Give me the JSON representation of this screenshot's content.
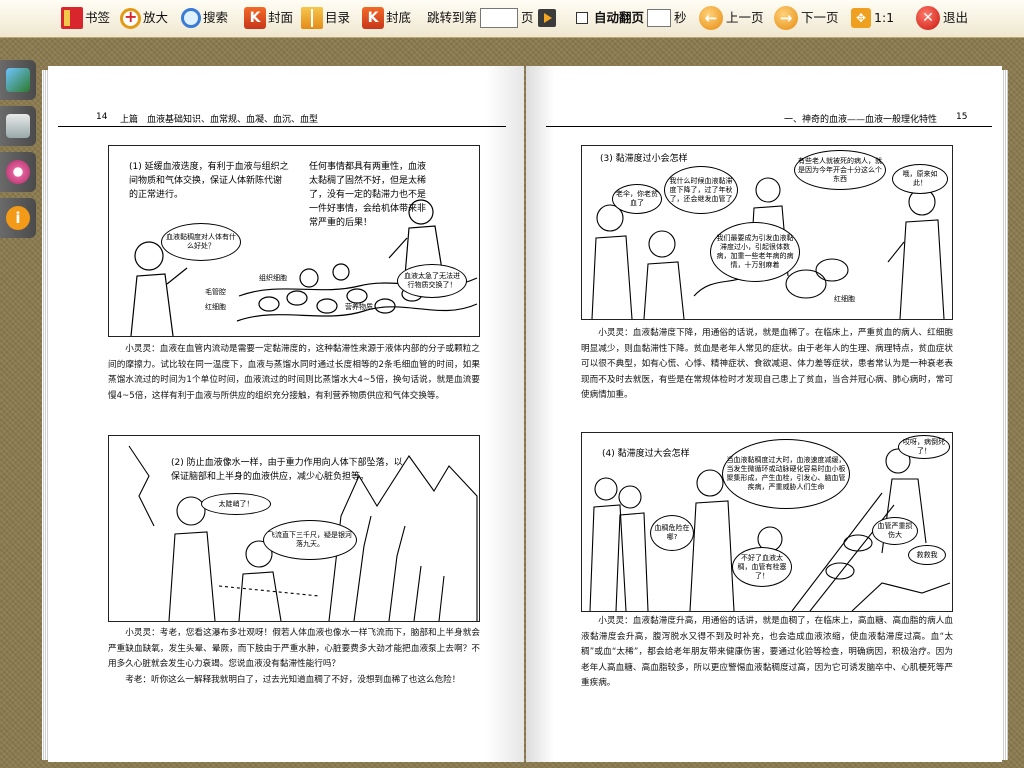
{
  "toolbar": {
    "bookmark": "书签",
    "zoom": "放大",
    "search": "搜索",
    "cover": "封面",
    "cover_icon": "K",
    "contents": "目录",
    "back_cover": "封底",
    "back_cover_icon": "K",
    "goto_prefix": "跳转到第",
    "goto_suffix": "页",
    "auto_flip": "自动翻页",
    "seconds": "秒",
    "prev": "上一页",
    "next": "下一页",
    "ratio": "1:1",
    "exit": "退出"
  },
  "left_page": {
    "page_number": "14",
    "running_head": "上篇　血液基础知识、血常规、血凝、血沉、血型",
    "panel1": {
      "caption_a": "(1) 延缓血液迭度，有利于血液与组织之间物质和气体交换，保证人体新陈代谢的正常进行。",
      "caption_b": "任何事情都具有两重性，血液太黏稠了固然不好，但是太稀了，没有一定的黏滞力也不是一件好事情，会给机体带来非常严重的后果！",
      "bubble_elder": "血液黏稠度对人体有什么好处？",
      "bubble_right": "血液太急了无法进行物质交换了！",
      "label_cells": "组织细胞",
      "label_capillary": "毛管腔",
      "label_rbc": "红细胞",
      "label_nutrients": "营养物质"
    },
    "text1": "小灵灵：血液在血管内流动是需要一定黏滞度的，这种黏滞性来源于液体内部的分子或颗粒之间的摩擦力。试比较在同一温度下，血液与蒸馏水同时通过长度相等的2条毛细血管的时间，如果蒸馏水流过的时间为1个单位时间，血液流过的时间则比蒸馏水大4~5倍，换句话说，就是血流要慢4~5倍，这样有利于血液与所供应的组织充分接触，有利营养物质供应和气体交换等。",
    "panel2": {
      "caption": "(2) 防止血液像水一样，由于重力作用向人体下部坠落，以保证脑部和上半身的血液供应，减少心脏负担等。",
      "bubble_hiker": "太陡峭了！",
      "bubble_mid": "飞流直下三千尺，疑是银河落九天。"
    },
    "text2a": "小灵灵：考老，您看这瀑布多壮观呀！假若人体血液也像水一样飞流而下，脑部和上半身就会严重缺血缺氧，发生头晕、晕厥，而下肢由于严重水肿，心脏要费多大劲才能把血液泵上去啊？不用多久心脏就会发生心力衰竭。您说血液没有黏滞性能行吗？",
    "text2b": "考老：听你这么一解释我就明白了，过去光知道血稠了不好，没想到血稀了也这么危险！"
  },
  "right_page": {
    "page_number": "15",
    "running_head": "一、神奇的血液——血液一般理化特性",
    "panel1": {
      "caption": "(3) 黏滞度过小会怎样",
      "bubble_old": "老伞，你老贫血了",
      "bubble_boy": "我什么时候血液黏滞度下降了，过了年秋了，还会继发血管了",
      "bubble_doc": "有些老人就被死的病人，就是因为今年开会十分这么个东西",
      "bubble_man": "我们最要成为引发血液黏滞度过小，引起很体数病，加重一些老年病的病情，十万别麻着",
      "bubble_surprise": "哦，原来如此！",
      "label_cell": "红细胞"
    },
    "text1": "小灵灵：血液黏滞度下降，用通俗的话说，就是血稀了。在临床上，严重贫血的病人、红细胞明显减少，则血黏滞性下降。贫血是老年人常见的症状。由于老年人的生理、病理特点，贫血症状可以很不典型，如有心慌、心悸、精神症状、食欲减退、体力差等症状，患者常认为是一种衰老表现而不及时去就医，有些是在常规体检时才发现自己患上了贫血，当合并冠心病、肺心病时，常可使病情加重。",
    "panel2": {
      "caption": "(4) 黏滞度过大会怎样",
      "bubble_doc": "当血液黏稠度过大时，血液速度减缓，当发生微循环或动脉硬化容易时血小板聚集形成，产生血栓，引发心、脑血管疾病，严重威胁人们生命",
      "bubble_top": "哎呀，病倒死了！",
      "bubble_cell": "血稠危险在哪?",
      "bubble_chef": "不好了血液太稠，血管有栓塞了！",
      "bubble_right": "血管严重损伤大",
      "bubble_help": "救救我"
    },
    "text2": "小灵灵：血液黏滞度升高，用通俗的话讲，就是血稠了，在临床上，高血糖、高血脂的病人血液黏滞度会升高，腹泻脱水又得不到及时补充，也会造成血液浓缩，使血液黏滞度过高。血“太稠”或血“太稀”，都会给老年朋友带来健康伤害，要通过化验等检查，明确病因，积极治疗。因为老年人高血糖、高血脂较多，所以更应警惕血液黏稠度过高，因为它可诱发脑卒中、心肌梗死等严重疾病。"
  }
}
